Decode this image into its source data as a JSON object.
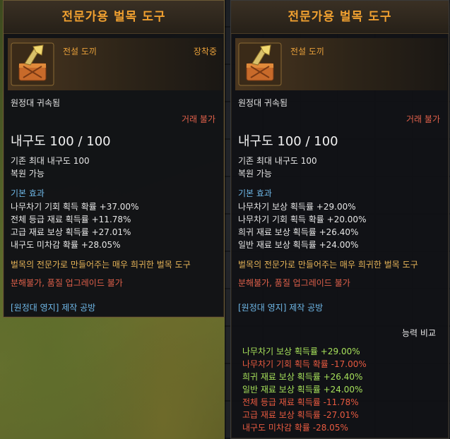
{
  "left_tooltip": {
    "title": "전문가용 벌목 도구",
    "grade": "전설 도끼",
    "equipped": "장착중",
    "binding": "원정대 귀속됨",
    "trade": "거래 불가",
    "durability": "내구도 100 / 100",
    "max_durability": "기존 최대 내구도 100",
    "restorable": "복원 가능",
    "base_effect_header": "기본 효과",
    "effects": [
      "나무차기 기회 획득 확률 +37.00%",
      "전체 등급 재료 획득률 +11.78%",
      "고급 재료 보상 획득률 +27.01%",
      "내구도 미차감 확률 +28.05%"
    ],
    "description": "벌목의 전문가로 만들어주는 매우 희귀한 벌목 도구",
    "restrictions": "분해불가, 품질 업그레이드 불가",
    "source": "[원정대 영지] 제작 공방"
  },
  "right_tooltip": {
    "title": "전문가용 벌목 도구",
    "grade": "전설 도끼",
    "binding": "원정대 귀속됨",
    "trade": "거래 불가",
    "durability": "내구도 100 / 100",
    "max_durability": "기존 최대 내구도 100",
    "restorable": "복원 가능",
    "base_effect_header": "기본 효과",
    "effects": [
      "나무차기 보상 획득률 +29.00%",
      "나무차기 기회 획득 확률 +20.00%",
      "희귀 재료 보상 획득률 +26.40%",
      "일반 재료 보상 획득률 +24.00%"
    ],
    "description": "벌목의 전문가로 만들어주는 매우 희귀한 벌목 도구",
    "restrictions": "분해불가, 품질 업그레이드 불가",
    "source": "[원정대 영지] 제작 공방",
    "compare_header": "능력 비교",
    "compare": [
      {
        "text": "나무차기 보상 획득률 +29.00%",
        "kind": "plus"
      },
      {
        "text": "나무차기 기회 획득 확률 -17.00%",
        "kind": "minus"
      },
      {
        "text": "희귀 재료 보상 획득률 +26.40%",
        "kind": "plus"
      },
      {
        "text": "일반 재료 보상 획득률 +24.00%",
        "kind": "plus"
      },
      {
        "text": "전체 등급 재료 획득률 -11.78%",
        "kind": "minus"
      },
      {
        "text": "고급 재료 보상 획득률 -27.01%",
        "kind": "minus"
      },
      {
        "text": "내구도 미차감 확률 -28.05%",
        "kind": "minus"
      }
    ]
  },
  "colors": {
    "title": "#f0a030",
    "grade": "#e8a03a",
    "untradeable": "#e0604a",
    "effect_header": "#6fb8e8",
    "description": "#e6b458",
    "increase": "#a6e05a",
    "decrease": "#e85a40"
  }
}
